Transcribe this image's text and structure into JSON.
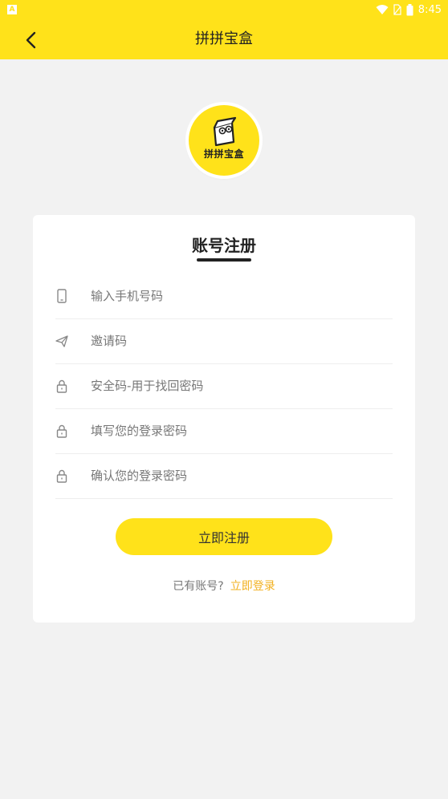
{
  "status": {
    "time": "8:45"
  },
  "nav": {
    "title": "拼拼宝盒"
  },
  "logo": {
    "text": "拼拼宝盒"
  },
  "form": {
    "title": "账号注册",
    "fields": [
      {
        "icon": "phone-icon",
        "placeholder": "输入手机号码",
        "value": ""
      },
      {
        "icon": "send-icon",
        "placeholder": "邀请码",
        "value": ""
      },
      {
        "icon": "lock-icon",
        "placeholder": "安全码-用于找回密码",
        "value": ""
      },
      {
        "icon": "lock-icon",
        "placeholder": "填写您的登录密码",
        "value": ""
      },
      {
        "icon": "lock-icon",
        "placeholder": "确认您的登录密码",
        "value": ""
      }
    ],
    "submit_label": "立即注册",
    "login_prompt": "已有账号?",
    "login_link": "立即登录"
  },
  "colors": {
    "brand": "#ffe21a",
    "link": "#f2b01e",
    "background": "#f2f2f2"
  }
}
